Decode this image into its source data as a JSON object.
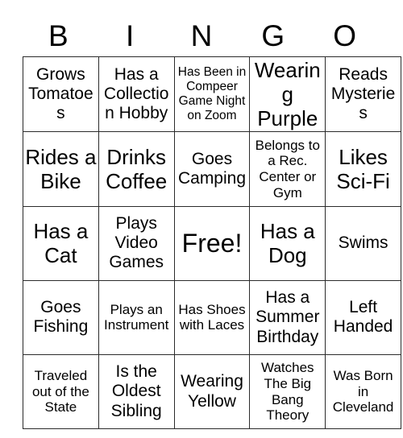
{
  "card": {
    "header_letters": [
      "B",
      "I",
      "N",
      "G",
      "O"
    ],
    "rows": [
      [
        {
          "text": "Grows Tomatoes",
          "size": "md"
        },
        {
          "text": "Has a Collection Hobby",
          "size": "md"
        },
        {
          "text": "Has Been in Compeer Game Night on Zoom",
          "size": "xs"
        },
        {
          "text": "Wearing Purple",
          "size": "lg"
        },
        {
          "text": "Reads Mysteries",
          "size": "md"
        }
      ],
      [
        {
          "text": "Rides a Bike",
          "size": "lg"
        },
        {
          "text": "Drinks Coffee",
          "size": "lg"
        },
        {
          "text": "Goes Camping",
          "size": "md"
        },
        {
          "text": "Belongs to a Rec. Center or Gym",
          "size": "sm"
        },
        {
          "text": "Likes Sci-Fi",
          "size": "lg"
        }
      ],
      [
        {
          "text": "Has a Cat",
          "size": "lg"
        },
        {
          "text": "Plays Video Games",
          "size": "md"
        },
        {
          "text": "Free!",
          "size": "xl"
        },
        {
          "text": "Has a Dog",
          "size": "lg"
        },
        {
          "text": "Swims",
          "size": "md"
        }
      ],
      [
        {
          "text": "Goes Fishing",
          "size": "md"
        },
        {
          "text": "Plays an Instrument",
          "size": "sm"
        },
        {
          "text": "Has Shoes with Laces",
          "size": "sm"
        },
        {
          "text": "Has a Summer Birthday",
          "size": "md"
        },
        {
          "text": "Left Handed",
          "size": "md"
        }
      ],
      [
        {
          "text": "Traveled out of the State",
          "size": "sm"
        },
        {
          "text": "Is the Oldest Sibling",
          "size": "md"
        },
        {
          "text": "Wearing Yellow",
          "size": "md"
        },
        {
          "text": "Watches The Big Bang Theory",
          "size": "sm"
        },
        {
          "text": "Was Born in Cleveland",
          "size": "sm"
        }
      ]
    ],
    "colors": {
      "grid_line": "#2b2b2b",
      "text": "#000000",
      "background": "#ffffff"
    }
  }
}
